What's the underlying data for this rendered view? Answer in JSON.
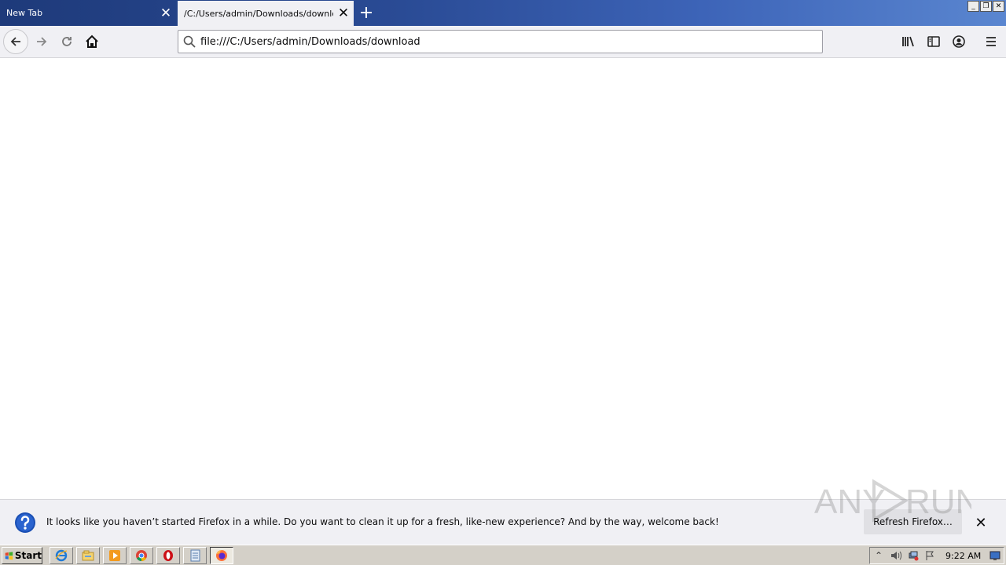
{
  "tabs": [
    {
      "label": "New Tab",
      "active": false
    },
    {
      "label": "/C:/Users/admin/Downloads/download",
      "active": true
    }
  ],
  "window_controls": {
    "minimize": "_",
    "restore": "❐",
    "close": "✕"
  },
  "urlbar": {
    "value": "file:///C:/Users/admin/Downloads/download"
  },
  "notification": {
    "message": "It looks like you haven’t started Firefox in a while. Do you want to clean it up for a fresh, like-new experience? And by the way, welcome back!",
    "button_label": "Refresh Firefox…"
  },
  "watermark": {
    "text_left": "ANY",
    "text_right": "RUN"
  },
  "taskbar": {
    "start_label": "Start",
    "apps": [
      "ie-icon",
      "explorer-icon",
      "media-player-icon",
      "chrome-icon",
      "opera-icon",
      "notepad-icon",
      "firefox-icon"
    ],
    "clock": "9:22 AM"
  },
  "colors": {
    "accent": "#0a84ff",
    "titlebar": "#2a4b95",
    "toolbar": "#f0f0f4"
  }
}
